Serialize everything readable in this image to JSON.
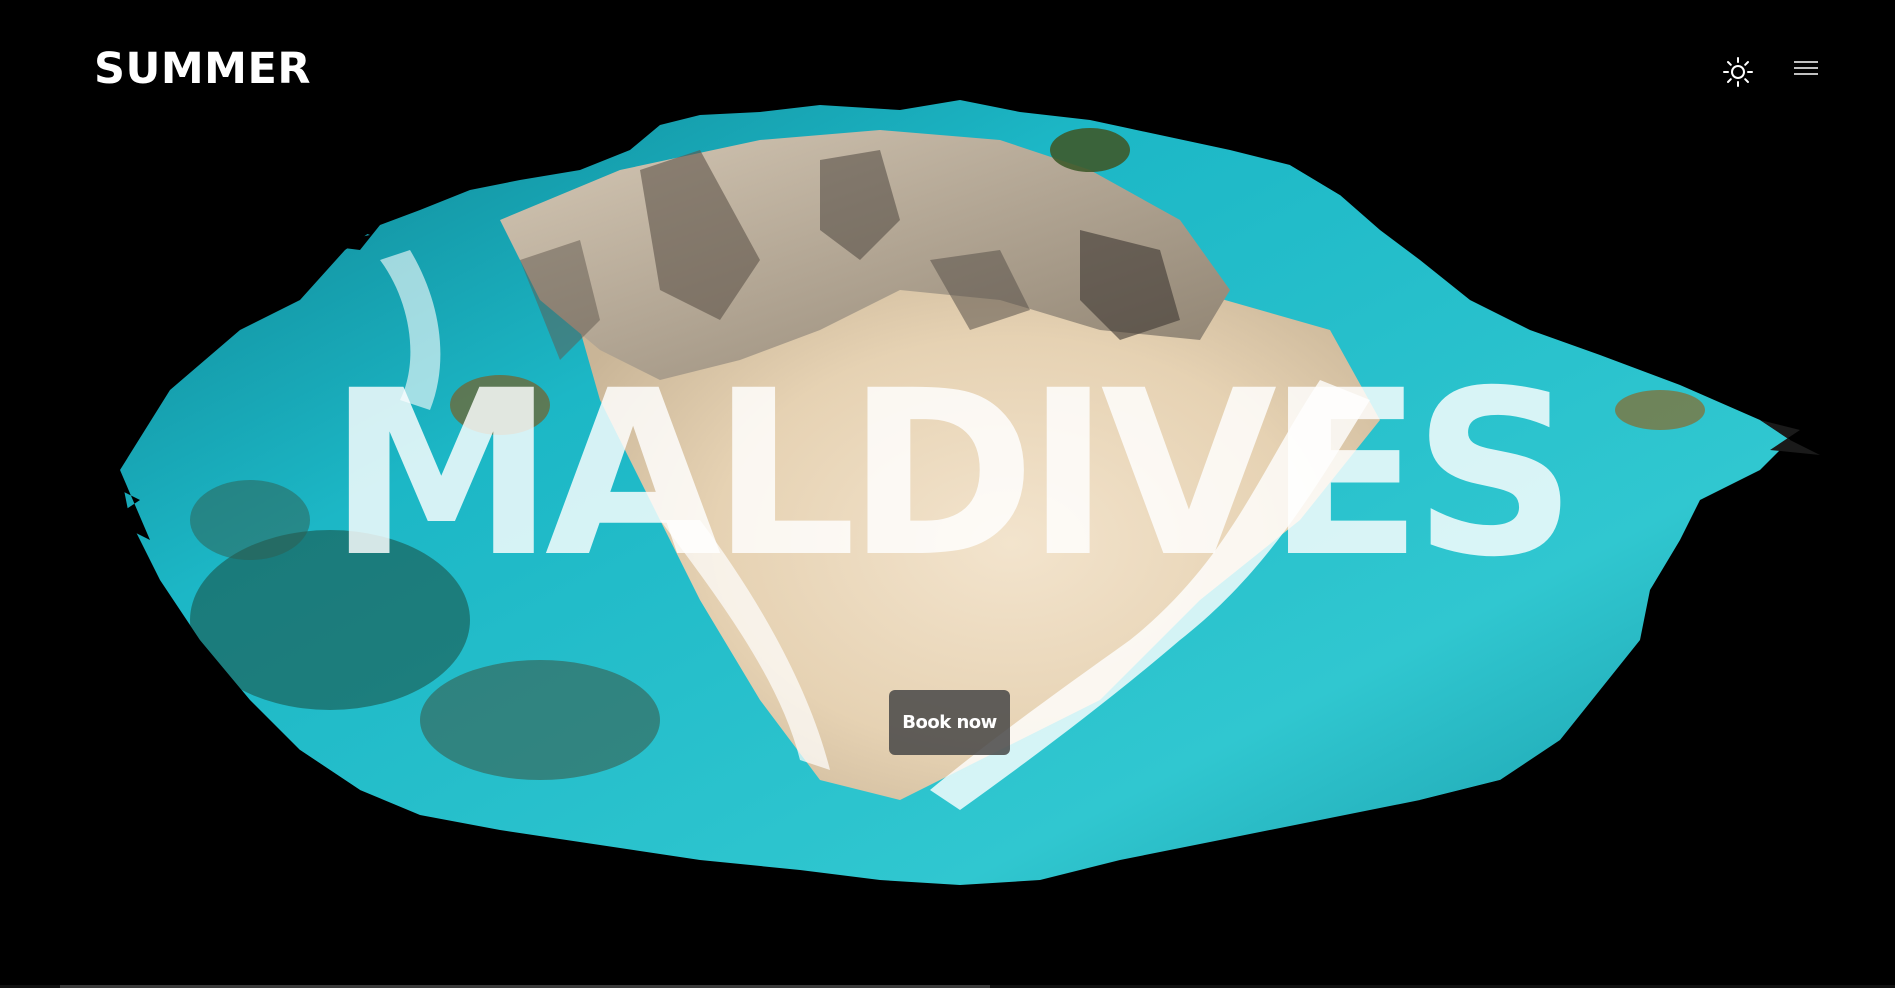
{
  "header": {
    "logo": "SUMMER",
    "theme_toggle_icon": "sun-icon",
    "menu_icon": "hamburger-menu-icon"
  },
  "hero": {
    "headline": "MALDIVES",
    "cta_label": "Book now",
    "image_description_icon": "brush-stroke-beach-image"
  },
  "colors": {
    "background": "#000000",
    "text": "#ffffff",
    "water": "#1fb8c8",
    "sand": "#e8d6bd",
    "rock": "#b9aa94",
    "button_bg": "#464646"
  }
}
